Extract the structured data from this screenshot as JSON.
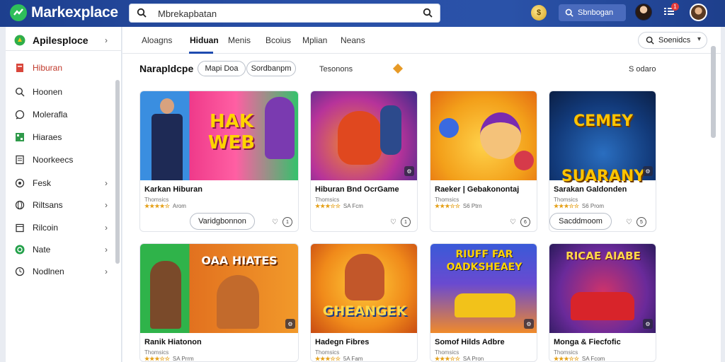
{
  "app": {
    "brand": "Markexplace",
    "search_value": "Mbrekapbatan",
    "top_button": "Sbnbogan",
    "notif_count": "1"
  },
  "sidebar": {
    "items": [
      {
        "label": "Apilesploce",
        "icon": "logo-icon",
        "chevron": true
      },
      {
        "label": "Hiburan",
        "icon": "file-icon",
        "chevron": false
      },
      {
        "label": "Hoonen",
        "icon": "search-icon",
        "chevron": false
      },
      {
        "label": "Molerafla",
        "icon": "chat-icon",
        "chevron": false
      },
      {
        "label": "Hiaraes",
        "icon": "grid-icon",
        "chevron": false
      },
      {
        "label": "Noorkeecs",
        "icon": "document-icon",
        "chevron": false
      },
      {
        "label": "Fesk",
        "icon": "gear-icon",
        "chevron": true
      },
      {
        "label": "Riltsans",
        "icon": "globe-icon",
        "chevron": true
      },
      {
        "label": "Rilcoin",
        "icon": "calendar-icon",
        "chevron": true
      },
      {
        "label": "Nate",
        "icon": "check-circle-icon",
        "chevron": true
      },
      {
        "label": "Nodlnen",
        "icon": "clock-icon",
        "chevron": true
      }
    ]
  },
  "tabs": [
    "Aloagns",
    "Hiduan",
    "Menis",
    "Bcoius",
    "Mplian",
    "Neans"
  ],
  "sort_label": "Soenidcs",
  "filters": {
    "title": "Narapldcpe",
    "chip1": "Mapi Doa",
    "chip2": "Sordbanpm",
    "text1": "Tesonons",
    "right": "S odaro"
  },
  "cards": [
    {
      "title": "Karkan Hiburan",
      "meta": "Thomsics",
      "rating": "★★★★☆",
      "rating_text": "Arom",
      "action": "Varidgbonnon",
      "count": "1",
      "thumb_word": "HAK WEB"
    },
    {
      "title": "Hiburan Bnd OcrGame",
      "meta": "Thomsics",
      "rating": "★★★☆☆",
      "rating_text": "SA Fcm",
      "action": "",
      "count": "1",
      "thumb_word": ""
    },
    {
      "title": "Raeker | Gebakonontaj",
      "meta": "Thomsics",
      "rating": "★★★☆☆",
      "rating_text": "S6 Ptrn",
      "action": "",
      "count": "6",
      "thumb_word": ""
    },
    {
      "title": "Sarakan Galdonden",
      "meta": "Thomsics",
      "rating": "★★★☆☆",
      "rating_text": "S6 Prom",
      "action": "Sacddmoom",
      "count": "5",
      "thumb_word": "CEMEY SUARANY"
    },
    {
      "title": "Ranik Hiatonon",
      "meta": "Thomsics",
      "rating": "★★★☆☆",
      "rating_text": "SA Prrm",
      "action": "",
      "count": "",
      "thumb_word": "OAA HIATES"
    },
    {
      "title": "Hadegn Fibres",
      "meta": "Thomsics",
      "rating": "★★★☆☆",
      "rating_text": "5A Fam",
      "action": "",
      "count": "",
      "thumb_word": "GHEANGEK"
    },
    {
      "title": "Somof Hilds Adbre",
      "meta": "Thomsics",
      "rating": "★★★☆☆",
      "rating_text": "SA Pron",
      "action": "",
      "count": "",
      "thumb_word": "RIUFF FAR OADKSHEAEY"
    },
    {
      "title": "Monga & Fiecfofic",
      "meta": "Thomsics",
      "rating": "★★★☆☆",
      "rating_text": "SA Fcom",
      "action": "",
      "count": "",
      "thumb_word": "RICAE AIABE"
    }
  ]
}
